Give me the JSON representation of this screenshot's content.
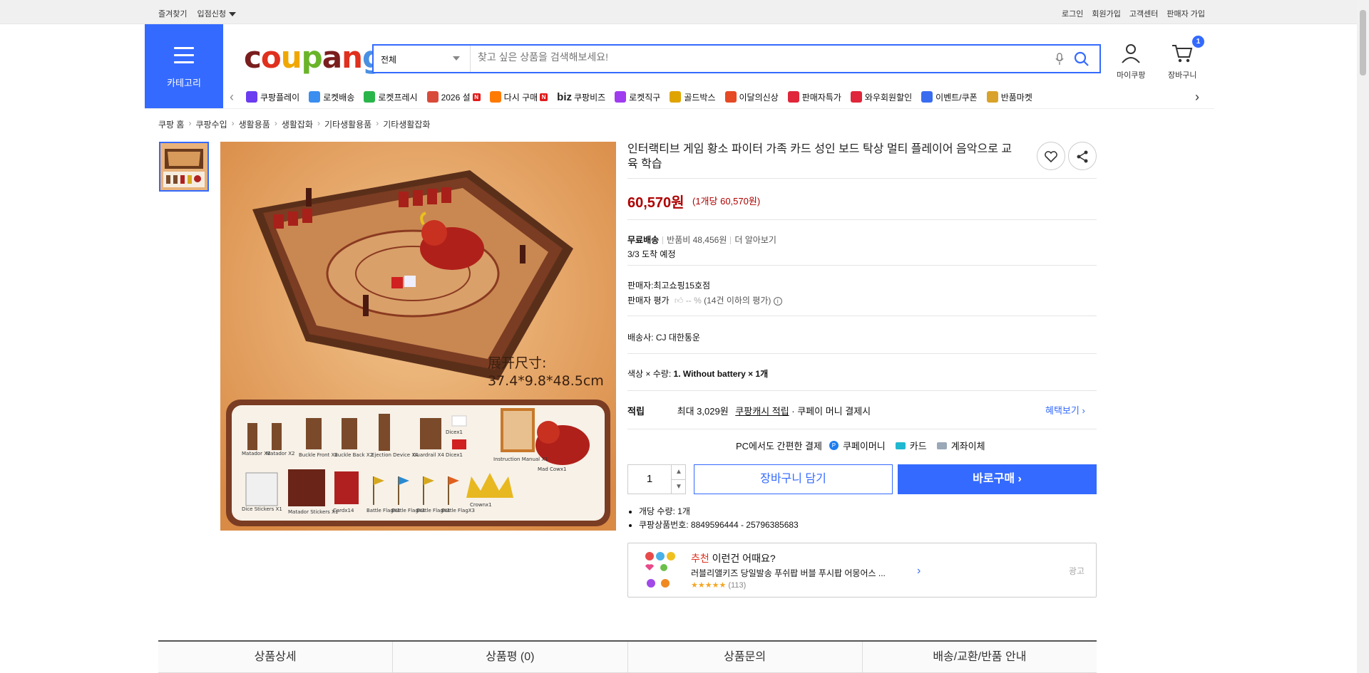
{
  "topbar": {
    "left": [
      "즐겨찾기",
      "입점신청"
    ],
    "right": [
      "로그인",
      "회원가입",
      "고객센터",
      "판매자 가입"
    ]
  },
  "category_label": "카테고리",
  "logo": "coupang",
  "search": {
    "category": "전체",
    "placeholder": "찾고 싶은 상품을 검색해보세요!"
  },
  "header": {
    "mycoupang": "마이쿠팡",
    "cart": "장바구니",
    "cart_count": "1"
  },
  "nav_items": [
    {
      "label": "쿠팡플레이",
      "color": "#6b3cf0",
      "new": false
    },
    {
      "label": "로켓배송",
      "color": "#3a8ef0",
      "new": false
    },
    {
      "label": "로켓프레시",
      "color": "#2ab54a",
      "new": false
    },
    {
      "label": "2026 설",
      "color": "#d84b3a",
      "new": true
    },
    {
      "label": "다시 구매",
      "color": "#ff7a00",
      "new": true
    },
    {
      "label": "쿠팡비즈",
      "prefix": "biz",
      "color": "#222",
      "new": false
    },
    {
      "label": "로켓직구",
      "color": "#a03cf0",
      "new": false
    },
    {
      "label": "골드박스",
      "color": "#e0a400",
      "new": false
    },
    {
      "label": "이달의신상",
      "color": "#e54a25",
      "new": false
    },
    {
      "label": "판매자특가",
      "color": "#e0263a",
      "new": false
    },
    {
      "label": "와우회원할인",
      "color": "#e0263a",
      "new": false
    },
    {
      "label": "이벤트/쿠폰",
      "color": "#3a6cf0",
      "new": false
    },
    {
      "label": "반품마켓",
      "color": "#d9a22a",
      "new": false
    }
  ],
  "breadcrumb": [
    "쿠팡 홈",
    "쿠팡수입",
    "생활용품",
    "생활잡화",
    "기타생활용품",
    "기타생활잡화"
  ],
  "product": {
    "title": "인터랙티브 게임 황소 파이터 가족 카드 성인 보드 탁상 멀티 플레이어 음악으로 교육 학습",
    "price": "60,570원",
    "unit_price": "(1개당 60,570원)",
    "shipping": {
      "free": "무료배송",
      "return_fee": "반품비 48,456원",
      "more": "더 알아보기",
      "arrival": "3/3 도착 예정"
    },
    "seller": "판매자:최고쇼핑15호점",
    "seller_rating_label": "판매자 평가",
    "seller_rating_value": "-- %",
    "seller_rating_note": "(14건 이하의 평가)",
    "carrier_label": "배송사:",
    "carrier": "CJ 대한통운",
    "option_label": "색상 × 수량:",
    "option_value": "1. Without battery × 1개",
    "reward_label": "적립",
    "reward_text": "최대 3,029원",
    "reward_link": "쿠팡캐시 적립",
    "reward_tail": "· 쿠페이 머니 결제시",
    "benefit": "혜택보기",
    "pay_label": "PC에서도 간편한 결제",
    "pay_methods": [
      "쿠페이머니",
      "카드",
      "계좌이체"
    ],
    "quantity": "1",
    "cart_button": "장바구니 담기",
    "buy_button": "바로구매",
    "bullets": [
      "개당 수량: 1개",
      "쿠팡상품번호: 8849596444 - 25796385683"
    ]
  },
  "image_text": {
    "size_title": "展开尺寸:",
    "size_value": "37.4*9.8*48.5cm",
    "parts": [
      "Matador X2",
      "Matador X2",
      "Buckle Front X2",
      "Buckle Back X2",
      "Ejection Device X4",
      "Guardrail X4",
      "Dicex1",
      "Dicex1",
      "Instruction Manual X1",
      "Mad Cowx1",
      "Dice Stickers X1",
      "Matador Stickers X1",
      "Cardx14",
      "Battle FlagX3",
      "Battle FlagX3",
      "Battle FlagX3",
      "Battle FlagX3",
      "Crownx1"
    ]
  },
  "ad": {
    "rec": "추천",
    "title": "이런건 어때요?",
    "product": "러블리앨키즈 당일발송 푸쉬팝 버블 푸시팝 어몽어스 ...",
    "reviews": "(113)",
    "ad_label": "광고"
  },
  "tabs": [
    "상품상세",
    "상품평 (0)",
    "상품문의",
    "배송/교환/반품 안내"
  ]
}
